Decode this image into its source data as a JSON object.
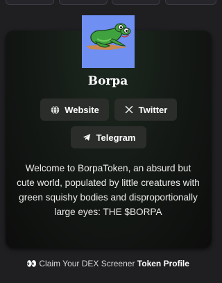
{
  "token": {
    "name": "Borpa",
    "description": "Welcome to BorpaToken, an absurd but cute world, populated by little creatures with green squishy bodies and disproportionally large eyes: THE $BORPA"
  },
  "links": {
    "website_label": "Website",
    "twitter_label": "Twitter",
    "telegram_label": "Telegram"
  },
  "claim": {
    "emoji": "👀",
    "text": "Claim Your DEX Screener",
    "strong": "Token Profile"
  },
  "icons": {
    "website": "globe-icon",
    "twitter": "x-logo-icon",
    "telegram": "paper-plane-icon"
  },
  "colors": {
    "background": "#1f1f22",
    "card": "#0c0d0c",
    "button": "#2b2d2b",
    "image_bg": "#6f8ff2",
    "frog_green": "#3fa23f"
  }
}
